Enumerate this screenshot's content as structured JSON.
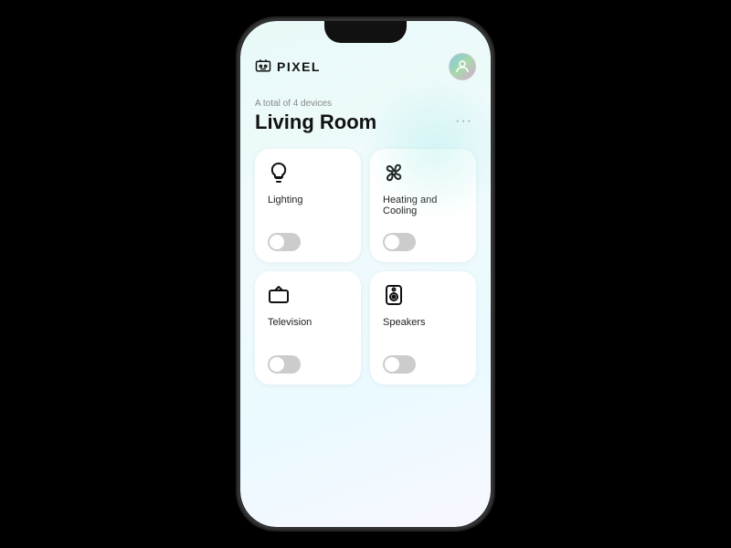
{
  "app": {
    "logo_text": "PIXEL",
    "logo_icon": "📺"
  },
  "room": {
    "device_count_label": "A total of 4 devices",
    "name": "Living Room",
    "more_icon": "···"
  },
  "devices": [
    {
      "id": "lighting",
      "name": "Lighting",
      "icon": "lightbulb",
      "toggle_on": false
    },
    {
      "id": "heating-cooling",
      "name": "Heating and Cooling",
      "icon": "fan",
      "toggle_on": false
    },
    {
      "id": "television",
      "name": "Television",
      "icon": "tv",
      "toggle_on": false
    },
    {
      "id": "speakers",
      "name": "Speakers",
      "icon": "speaker",
      "toggle_on": false
    }
  ]
}
